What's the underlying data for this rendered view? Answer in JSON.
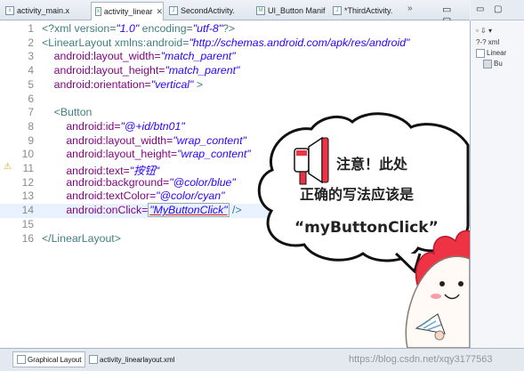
{
  "tabs": [
    {
      "label": "activity_main.x",
      "active": false
    },
    {
      "label": "activity_linear",
      "active": true
    },
    {
      "label": "SecondActivity.",
      "active": false
    },
    {
      "label": "UI_Button Manif",
      "active": false
    },
    {
      "label": "*ThirdActivity.",
      "active": false
    }
  ],
  "tabbar_overflow": "»",
  "window_controls": "▭ ▢",
  "code_lines": [
    {
      "n": "1",
      "segments": [
        [
          "kw",
          "<?xml version="
        ],
        [
          "val",
          "\"1.0\""
        ],
        [
          "kw",
          " encoding="
        ],
        [
          "val",
          "\"utf-8\""
        ],
        [
          "kw",
          "?>"
        ]
      ]
    },
    {
      "n": "2",
      "segments": [
        [
          "kw",
          "<LinearLayout xmlns:android="
        ],
        [
          "val",
          "\"http://schemas.android.com/apk/res/android\""
        ]
      ]
    },
    {
      "n": "3",
      "segments": [
        [
          "attr",
          "    android:layout_width="
        ],
        [
          "val",
          "\"match_parent\""
        ]
      ]
    },
    {
      "n": "4",
      "segments": [
        [
          "attr",
          "    android:layout_height="
        ],
        [
          "val",
          "\"match_parent\""
        ]
      ]
    },
    {
      "n": "5",
      "segments": [
        [
          "attr",
          "    android:orientation="
        ],
        [
          "val",
          "\"vertical\""
        ],
        [
          "kw",
          " >"
        ]
      ]
    },
    {
      "n": "6",
      "segments": []
    },
    {
      "n": "7",
      "segments": [
        [
          "kw",
          "    <Button"
        ]
      ]
    },
    {
      "n": "8",
      "segments": [
        [
          "attr",
          "        android:id="
        ],
        [
          "val",
          "\"@+id/btn01\""
        ]
      ]
    },
    {
      "n": "9",
      "segments": [
        [
          "attr",
          "        android:layout_width="
        ],
        [
          "val",
          "\"wrap_content\""
        ]
      ]
    },
    {
      "n": "10",
      "segments": [
        [
          "attr",
          "        android:layout_height="
        ],
        [
          "val",
          "\"wrap_content\""
        ]
      ]
    },
    {
      "n": "11",
      "segments": [
        [
          "attr",
          "        android:text="
        ],
        [
          "val",
          "\"按钮\""
        ]
      ],
      "warning": true
    },
    {
      "n": "12",
      "segments": [
        [
          "attr",
          "        android:background="
        ],
        [
          "val",
          "\"@color/blue\""
        ]
      ]
    },
    {
      "n": "13",
      "segments": [
        [
          "attr",
          "        android:textColor="
        ],
        [
          "val",
          "\"@color/cyan\""
        ]
      ]
    },
    {
      "n": "14",
      "segments": [
        [
          "attr",
          "        android:onClick="
        ],
        [
          "val",
          "\"MyButtonClick\""
        ],
        [
          "kw",
          " />"
        ]
      ],
      "current": true
    },
    {
      "n": "15",
      "segments": []
    },
    {
      "n": "16",
      "segments": [
        [
          "kw",
          "</LinearLayout>"
        ]
      ]
    }
  ],
  "bubble": {
    "line1": "注意！此处",
    "line2": "正确的写法应该是",
    "line3": "“myButtonClick”"
  },
  "outline": {
    "item1": "?-? xml",
    "item2": "Linear",
    "item3": "Bu"
  },
  "bottom_tabs": [
    {
      "label": "Graphical Layout",
      "active": false
    },
    {
      "label": "activity_linearlayout.xml",
      "active": true
    }
  ],
  "watermark": "https://blog.csdn.net/xqy3177563",
  "colors": {
    "tag": "#3f7f7f",
    "attribute": "#7f007f",
    "value": "#2a00ff",
    "mascot": "#ee3344",
    "bubble_border": "#111111"
  }
}
